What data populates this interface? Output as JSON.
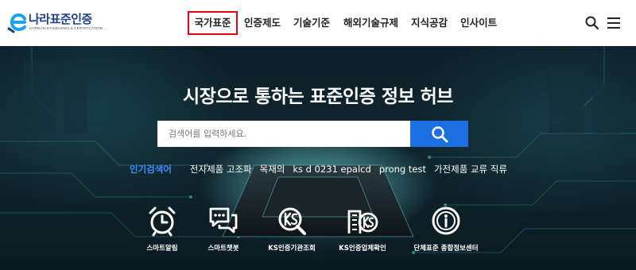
{
  "logo": {
    "title": "나라표준인증",
    "subtitle": "KOREAN STANDARDS & CERTIFICATION",
    "brand_color": "#1d3f86"
  },
  "nav": {
    "items": [
      "국가표준",
      "인증제도",
      "기술기준",
      "해외기술규제",
      "지식공감",
      "인사이트"
    ],
    "highlight_color": "#e60012"
  },
  "header_icons": [
    "search-icon",
    "hamburger-menu-icon"
  ],
  "hero": {
    "title": "시장으로 통하는 표준인증 정보 허브"
  },
  "search": {
    "placeholder": "검색어를 입력하세요.",
    "button_color": "#1c6fe0"
  },
  "popular": {
    "label": "인기검색어",
    "keywords": [
      "전자제품 고조파",
      "목재의",
      "ks d 0231 epalcd",
      "prong test",
      "가전제품 교류 직류"
    ]
  },
  "quick_links": [
    {
      "label": "스마트알림",
      "icon": "alarm-clock-icon"
    },
    {
      "label": "스마트챗봇",
      "icon": "chat-bubbles-icon"
    },
    {
      "label": "KS인증기관조회",
      "icon": "ks-search-icon"
    },
    {
      "label": "KS인증업체확인",
      "icon": "ks-building-icon"
    },
    {
      "label": "단체표준 종합정보센터",
      "icon": "info-circle-icon"
    }
  ]
}
